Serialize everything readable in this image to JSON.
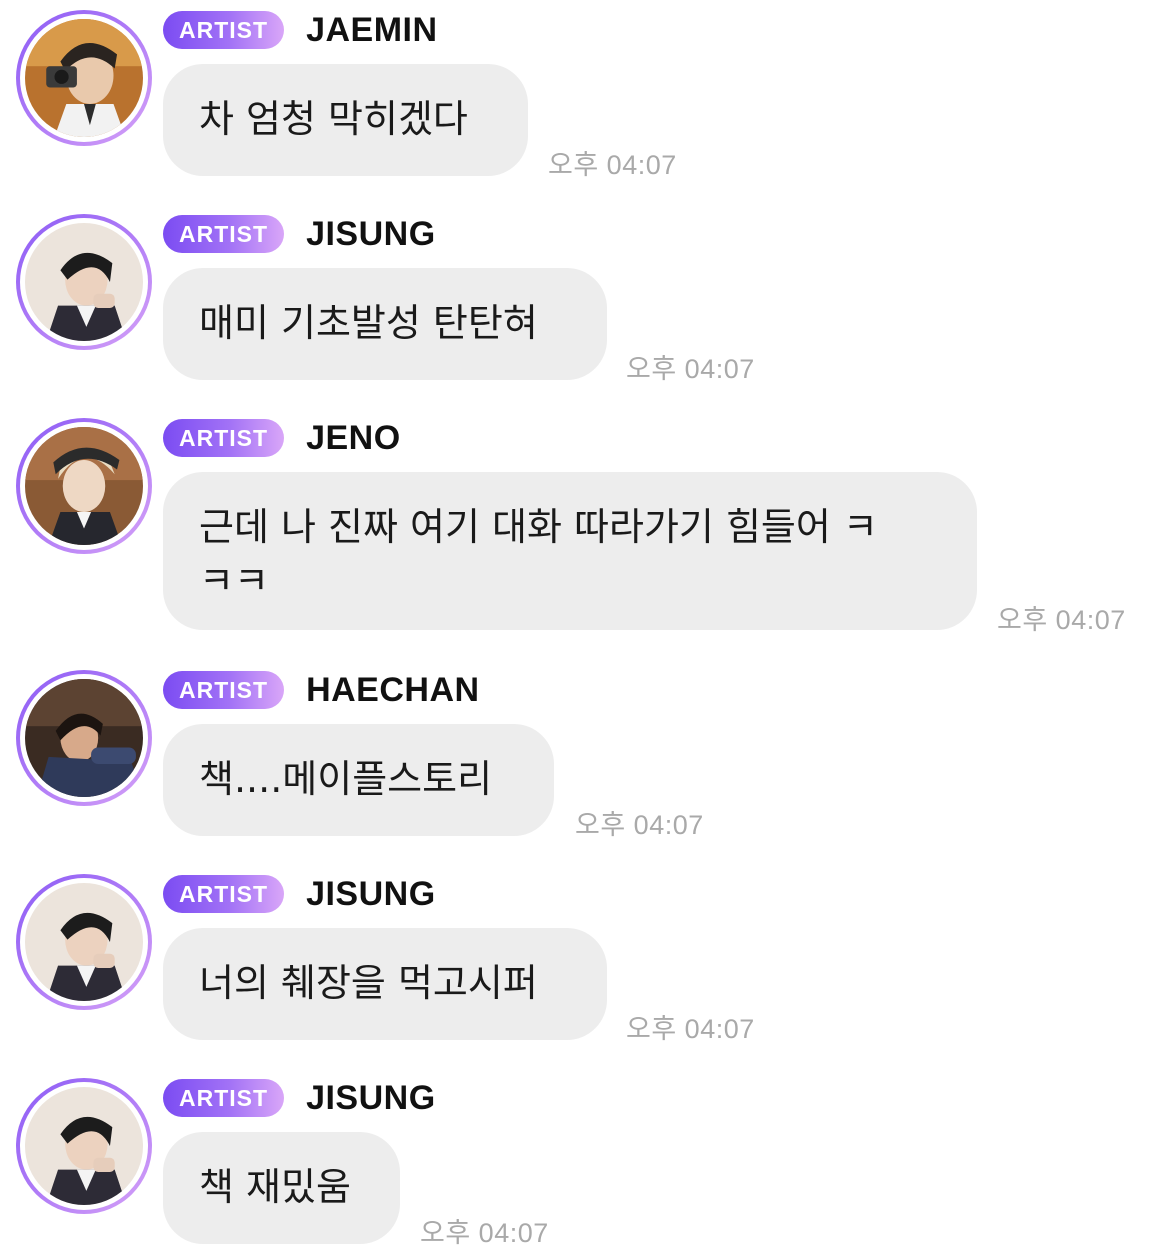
{
  "messages": [
    {
      "badge": "ARTIST",
      "name": "JAEMIN",
      "text": "차 엄청 막히겠다",
      "time": "오후 04:07"
    },
    {
      "badge": "ARTIST",
      "name": "JISUNG",
      "text": "매미 기초발성 탄탄혀",
      "time": "오후 04:07"
    },
    {
      "badge": "ARTIST",
      "name": "JENO",
      "text": "근데 나 진짜 여기 대화 따라가기 힘들어 ㅋ\nㅋㅋ",
      "time": "오후 04:07"
    },
    {
      "badge": "ARTIST",
      "name": "HAECHAN",
      "text": "책....메이플스토리",
      "time": "오후 04:07"
    },
    {
      "badge": "ARTIST",
      "name": "JISUNG",
      "text": "너의 췌장을 먹고시퍼",
      "time": "오후 04:07"
    },
    {
      "badge": "ARTIST",
      "name": "JISUNG",
      "text": "책 재밌움",
      "time": "오후 04:07"
    }
  ],
  "colors": {
    "badge_gradient_start": "#7b4cf2",
    "badge_gradient_end": "#d9a6f8",
    "bubble_bg": "#ededed",
    "time_text": "#a9a9a9"
  }
}
